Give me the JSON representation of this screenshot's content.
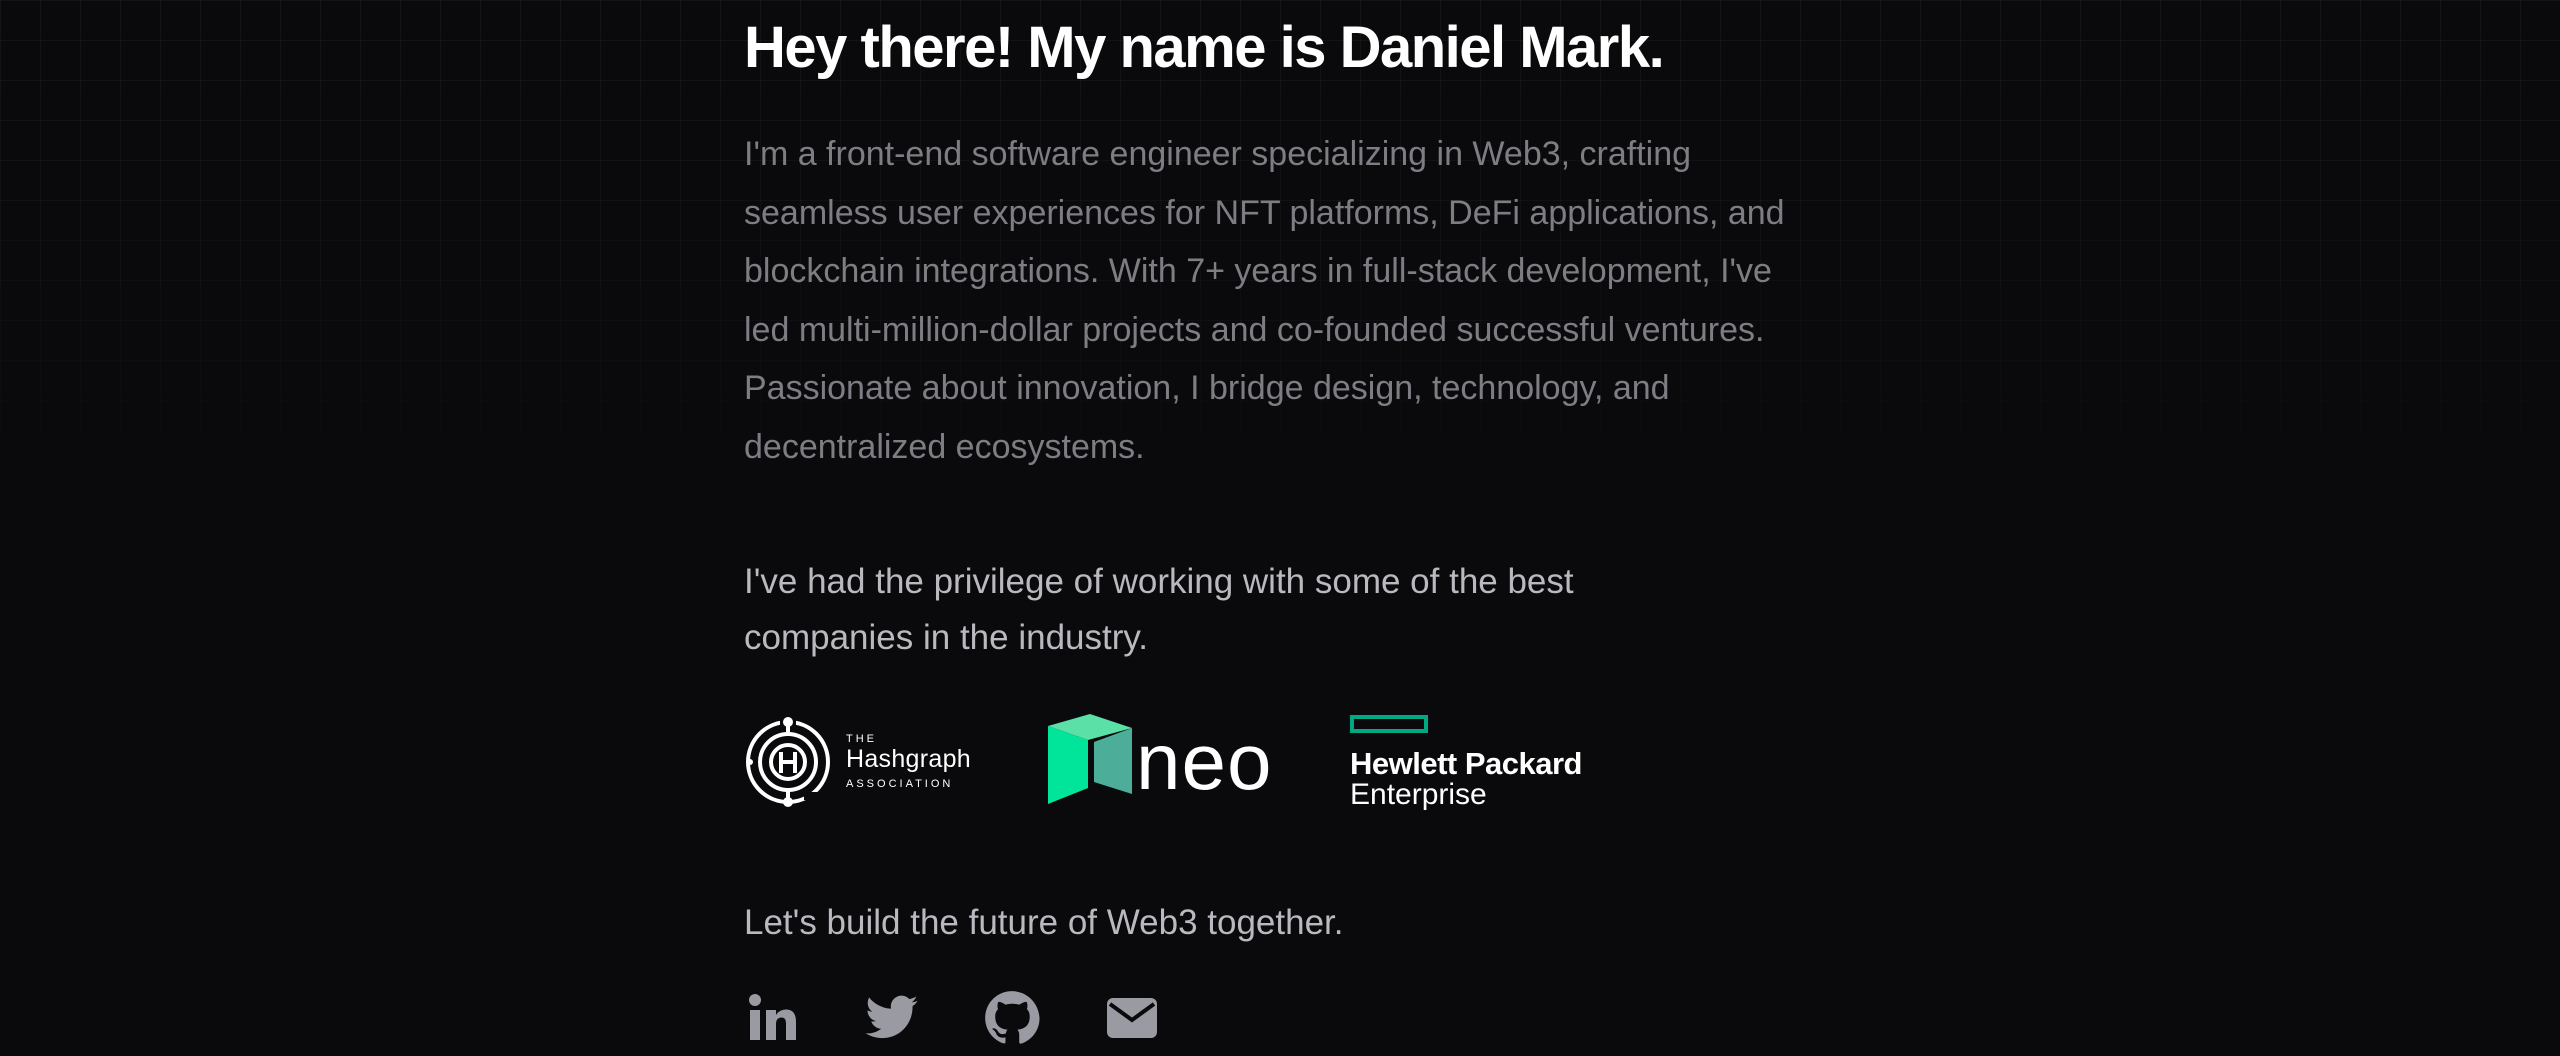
{
  "hero": {
    "heading": "Hey there! My name is Daniel Mark.",
    "intro": "I'm a front-end software engineer specializing in Web3, crafting seamless user experiences for NFT platforms, DeFi applications, and blockchain integrations. With 7+ years in full-stack development, I've led multi-million-dollar projects and co-founded successful ventures. Passionate about innovation, I bridge design, technology, and decentralized ecosystems."
  },
  "companies": {
    "text": "I've had the privilege of working with some of the best companies in the industry.",
    "logos": [
      {
        "name": "hashgraph-association",
        "icon": "hashgraph-h-icon",
        "small_top": "THE",
        "name_text": "Hashgraph",
        "small_bottom": "ASSOCIATION"
      },
      {
        "name": "neo",
        "icon": "neo-cube-icon",
        "name_text": "neo",
        "colors": [
          "#00e599",
          "#4cc3a1",
          "#3aa185"
        ]
      },
      {
        "name": "hewlett-packard-enterprise",
        "icon": "hpe-rectangle-icon",
        "line1": "Hewlett Packard",
        "line2": "Enterprise",
        "accent": "#01a982"
      }
    ]
  },
  "cta": {
    "text": "Let's build the future of Web3 together."
  },
  "socials": [
    {
      "name": "linkedin",
      "icon": "linkedin-icon"
    },
    {
      "name": "twitter",
      "icon": "twitter-icon"
    },
    {
      "name": "github",
      "icon": "github-icon"
    },
    {
      "name": "email",
      "icon": "mail-icon"
    }
  ],
  "colors": {
    "background": "#0a0a0c",
    "heading": "#ffffff",
    "intro_text": "#7d7d84",
    "body_text": "#b9b9bf",
    "icon": "#9a9aa2"
  }
}
